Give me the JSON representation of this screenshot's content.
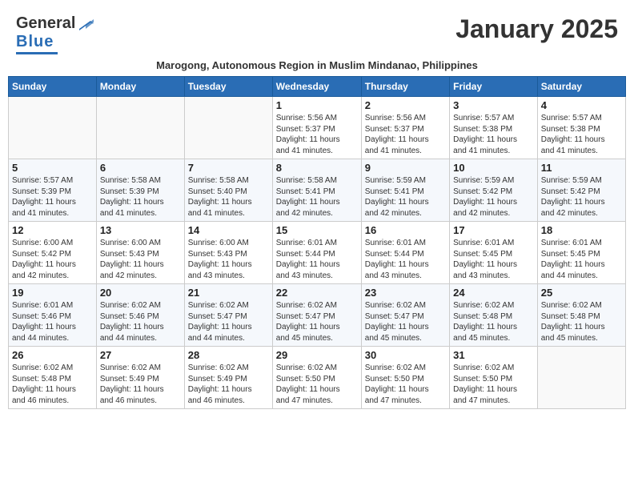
{
  "header": {
    "logo_general": "General",
    "logo_blue": "Blue",
    "month_title": "January 2025",
    "subtitle": "Marogong, Autonomous Region in Muslim Mindanao, Philippines"
  },
  "weekdays": [
    "Sunday",
    "Monday",
    "Tuesday",
    "Wednesday",
    "Thursday",
    "Friday",
    "Saturday"
  ],
  "weeks": [
    [
      {
        "day": "",
        "info": ""
      },
      {
        "day": "",
        "info": ""
      },
      {
        "day": "",
        "info": ""
      },
      {
        "day": "1",
        "info": "Sunrise: 5:56 AM\nSunset: 5:37 PM\nDaylight: 11 hours\nand 41 minutes."
      },
      {
        "day": "2",
        "info": "Sunrise: 5:56 AM\nSunset: 5:37 PM\nDaylight: 11 hours\nand 41 minutes."
      },
      {
        "day": "3",
        "info": "Sunrise: 5:57 AM\nSunset: 5:38 PM\nDaylight: 11 hours\nand 41 minutes."
      },
      {
        "day": "4",
        "info": "Sunrise: 5:57 AM\nSunset: 5:38 PM\nDaylight: 11 hours\nand 41 minutes."
      }
    ],
    [
      {
        "day": "5",
        "info": "Sunrise: 5:57 AM\nSunset: 5:39 PM\nDaylight: 11 hours\nand 41 minutes."
      },
      {
        "day": "6",
        "info": "Sunrise: 5:58 AM\nSunset: 5:39 PM\nDaylight: 11 hours\nand 41 minutes."
      },
      {
        "day": "7",
        "info": "Sunrise: 5:58 AM\nSunset: 5:40 PM\nDaylight: 11 hours\nand 41 minutes."
      },
      {
        "day": "8",
        "info": "Sunrise: 5:58 AM\nSunset: 5:41 PM\nDaylight: 11 hours\nand 42 minutes."
      },
      {
        "day": "9",
        "info": "Sunrise: 5:59 AM\nSunset: 5:41 PM\nDaylight: 11 hours\nand 42 minutes."
      },
      {
        "day": "10",
        "info": "Sunrise: 5:59 AM\nSunset: 5:42 PM\nDaylight: 11 hours\nand 42 minutes."
      },
      {
        "day": "11",
        "info": "Sunrise: 5:59 AM\nSunset: 5:42 PM\nDaylight: 11 hours\nand 42 minutes."
      }
    ],
    [
      {
        "day": "12",
        "info": "Sunrise: 6:00 AM\nSunset: 5:42 PM\nDaylight: 11 hours\nand 42 minutes."
      },
      {
        "day": "13",
        "info": "Sunrise: 6:00 AM\nSunset: 5:43 PM\nDaylight: 11 hours\nand 42 minutes."
      },
      {
        "day": "14",
        "info": "Sunrise: 6:00 AM\nSunset: 5:43 PM\nDaylight: 11 hours\nand 43 minutes."
      },
      {
        "day": "15",
        "info": "Sunrise: 6:01 AM\nSunset: 5:44 PM\nDaylight: 11 hours\nand 43 minutes."
      },
      {
        "day": "16",
        "info": "Sunrise: 6:01 AM\nSunset: 5:44 PM\nDaylight: 11 hours\nand 43 minutes."
      },
      {
        "day": "17",
        "info": "Sunrise: 6:01 AM\nSunset: 5:45 PM\nDaylight: 11 hours\nand 43 minutes."
      },
      {
        "day": "18",
        "info": "Sunrise: 6:01 AM\nSunset: 5:45 PM\nDaylight: 11 hours\nand 44 minutes."
      }
    ],
    [
      {
        "day": "19",
        "info": "Sunrise: 6:01 AM\nSunset: 5:46 PM\nDaylight: 11 hours\nand 44 minutes."
      },
      {
        "day": "20",
        "info": "Sunrise: 6:02 AM\nSunset: 5:46 PM\nDaylight: 11 hours\nand 44 minutes."
      },
      {
        "day": "21",
        "info": "Sunrise: 6:02 AM\nSunset: 5:47 PM\nDaylight: 11 hours\nand 44 minutes."
      },
      {
        "day": "22",
        "info": "Sunrise: 6:02 AM\nSunset: 5:47 PM\nDaylight: 11 hours\nand 45 minutes."
      },
      {
        "day": "23",
        "info": "Sunrise: 6:02 AM\nSunset: 5:47 PM\nDaylight: 11 hours\nand 45 minutes."
      },
      {
        "day": "24",
        "info": "Sunrise: 6:02 AM\nSunset: 5:48 PM\nDaylight: 11 hours\nand 45 minutes."
      },
      {
        "day": "25",
        "info": "Sunrise: 6:02 AM\nSunset: 5:48 PM\nDaylight: 11 hours\nand 45 minutes."
      }
    ],
    [
      {
        "day": "26",
        "info": "Sunrise: 6:02 AM\nSunset: 5:48 PM\nDaylight: 11 hours\nand 46 minutes."
      },
      {
        "day": "27",
        "info": "Sunrise: 6:02 AM\nSunset: 5:49 PM\nDaylight: 11 hours\nand 46 minutes."
      },
      {
        "day": "28",
        "info": "Sunrise: 6:02 AM\nSunset: 5:49 PM\nDaylight: 11 hours\nand 46 minutes."
      },
      {
        "day": "29",
        "info": "Sunrise: 6:02 AM\nSunset: 5:50 PM\nDaylight: 11 hours\nand 47 minutes."
      },
      {
        "day": "30",
        "info": "Sunrise: 6:02 AM\nSunset: 5:50 PM\nDaylight: 11 hours\nand 47 minutes."
      },
      {
        "day": "31",
        "info": "Sunrise: 6:02 AM\nSunset: 5:50 PM\nDaylight: 11 hours\nand 47 minutes."
      },
      {
        "day": "",
        "info": ""
      }
    ]
  ]
}
